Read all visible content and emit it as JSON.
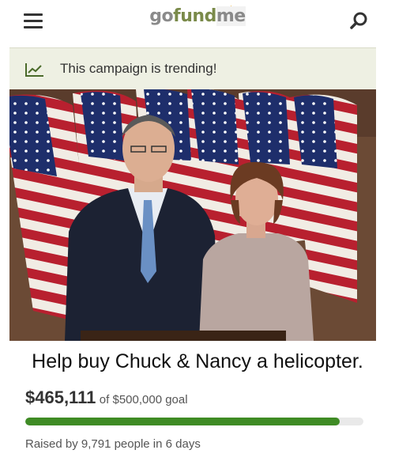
{
  "header": {
    "logo_go": "go",
    "logo_fund": "fund",
    "logo_me": "me",
    "menu_icon": "hamburger-menu-icon",
    "search_icon": "search-icon"
  },
  "trending": {
    "text": "This campaign is trending!",
    "icon": "trend-chart-icon"
  },
  "photo": {
    "description_icon": "campaign-photo"
  },
  "caption": "Help buy Chuck & Nancy a helicopter.",
  "funding": {
    "raised_amount": "$465,111",
    "goal_text": "of $500,000 goal",
    "progress_fraction": 0.93,
    "progress_color": "#3f8b25",
    "supporters_text": "Raised by 9,791 people in 6 days"
  },
  "colors": {
    "trend_bg": "#eef0e3",
    "brand_green": "#7a8a4a"
  }
}
